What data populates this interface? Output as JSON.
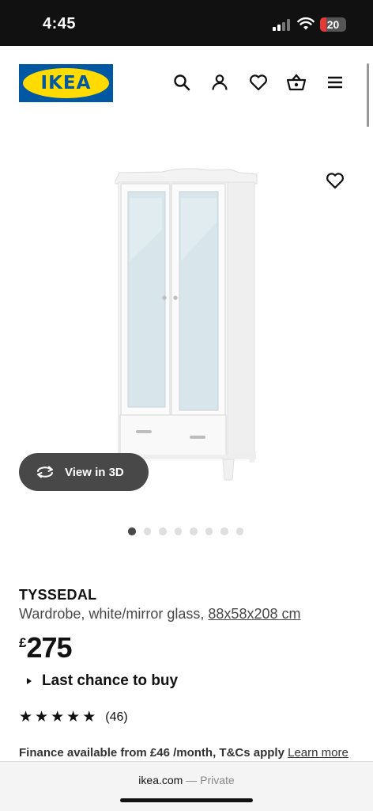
{
  "status_bar": {
    "time": "4:45",
    "battery": "20"
  },
  "header": {
    "logo_text": "IKEA",
    "icons": [
      "search-icon",
      "user-icon",
      "heart-icon",
      "basket-icon",
      "menu-icon"
    ]
  },
  "product": {
    "image_alt": "TYSSEDAL wardrobe",
    "view_3d_label": "View in 3D",
    "gallery_count": 8,
    "gallery_active": 0,
    "name": "TYSSEDAL",
    "description": "Wardrobe, white/mirror glass, ",
    "dimensions": "88x58x208 cm",
    "currency": "£",
    "price": "275",
    "availability": "Last chance to buy",
    "rating": {
      "stars": 5,
      "count": "(46)"
    },
    "finance_text": "Finance available from £46 /month, T&Cs apply",
    "learn_more": "Learn more"
  },
  "browser": {
    "domain": "ikea.com",
    "separator": " — ",
    "mode": "Private"
  },
  "colors": {
    "brand_blue": "#0058a3",
    "brand_yellow": "#ffdb00",
    "pill_bg": "#484848"
  }
}
